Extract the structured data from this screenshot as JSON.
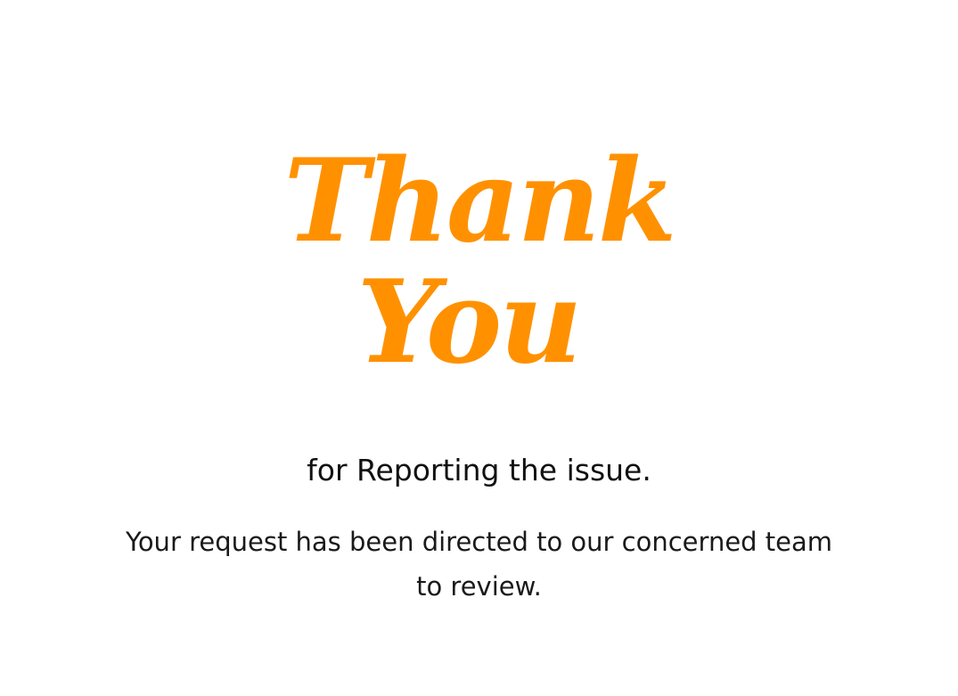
{
  "heading": {
    "line1": "Thank",
    "line2": "You",
    "color": "#ff9100"
  },
  "subtitle": "for Reporting the issue.",
  "message": "Your request has been directed to our concerned team to review."
}
